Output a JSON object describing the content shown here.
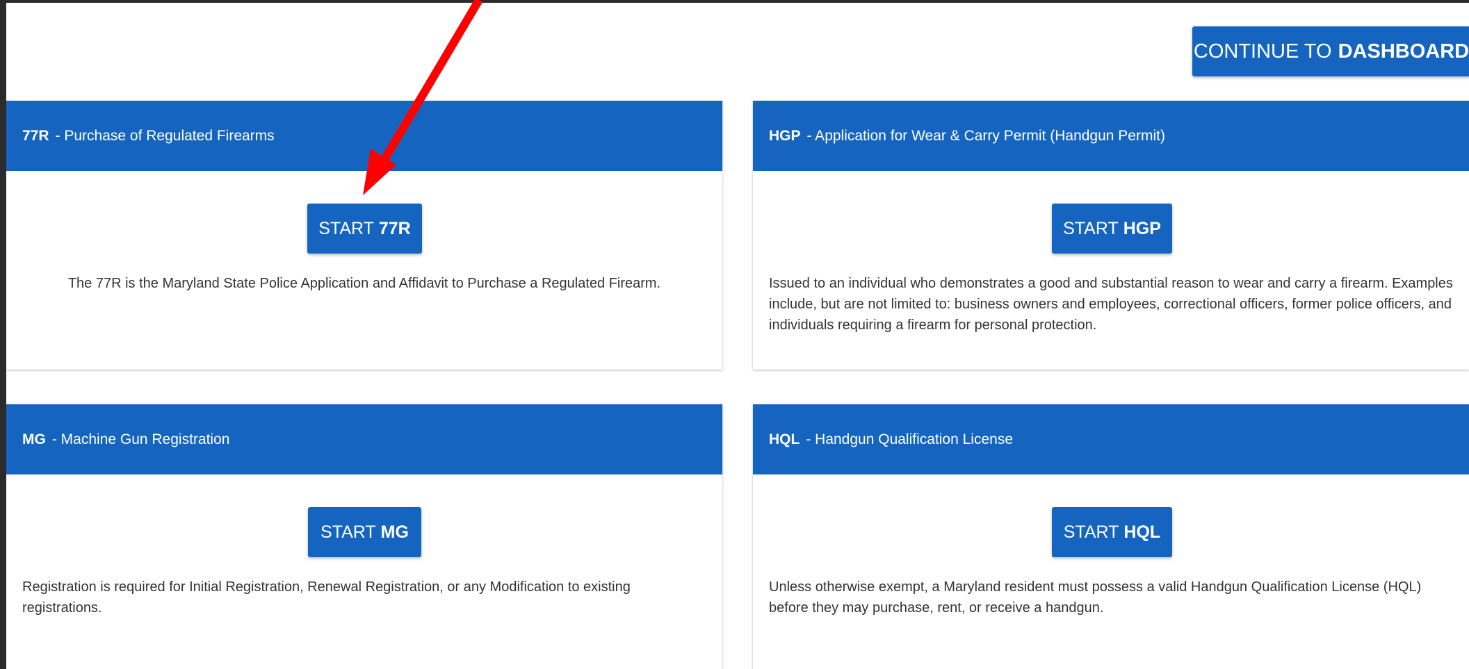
{
  "header": {
    "continue_prefix": "CONTINUE TO",
    "continue_bold": "DASHBOARD"
  },
  "cards": [
    {
      "code": "77R",
      "title": "- Purchase of Regulated Firearms",
      "button_prefix": "START",
      "button_bold": "77R",
      "description": "The 77R is the Maryland State Police Application and Affidavit to Purchase a Regulated Firearm."
    },
    {
      "code": "HGP",
      "title": "- Application for Wear & Carry Permit (Handgun Permit)",
      "button_prefix": "START",
      "button_bold": "HGP",
      "description": "Issued to an individual who demonstrates a good and substantial reason to wear and carry a firearm. Examples include, but are not limited to: business owners and employees, correctional officers, former police officers, and individuals requiring a firearm for personal protection."
    },
    {
      "code": "MG",
      "title": "- Machine Gun Registration",
      "button_prefix": "START",
      "button_bold": "MG",
      "description": "Registration is required for Initial Registration, Renewal Registration, or any Modification to existing registrations."
    },
    {
      "code": "HQL",
      "title": "- Handgun Qualification License",
      "button_prefix": "START",
      "button_bold": "HQL",
      "description": "Unless otherwise exempt, a Maryland resident must possess a valid Handgun Qualification License (HQL) before they may purchase, rent, or receive a handgun."
    }
  ],
  "colors": {
    "primary": "#1565c0",
    "annotation_arrow": "#ff0000",
    "frame": "#2b2b2b"
  },
  "icons": {
    "annotation": "red-arrow-annotation"
  }
}
